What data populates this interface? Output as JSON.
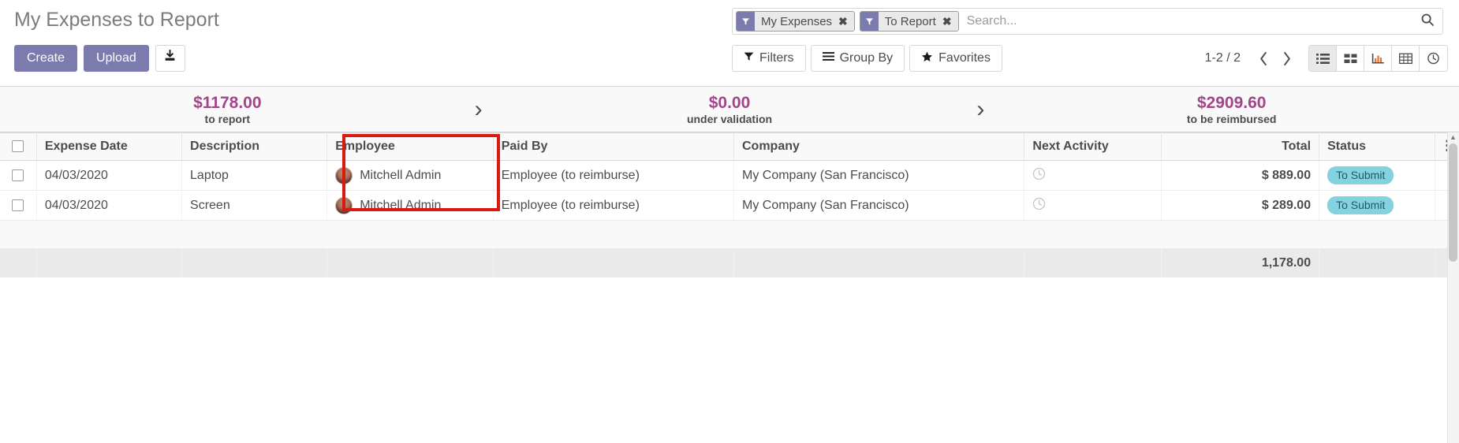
{
  "header": {
    "title": "My Expenses to Report",
    "buttons": {
      "create": "Create",
      "upload": "Upload",
      "import_icon": "download-tray-icon"
    }
  },
  "search": {
    "placeholder": "Search...",
    "value": "",
    "search_icon": "search-icon",
    "facets": [
      {
        "icon": "filter-funnel-icon",
        "label": "My Expenses",
        "close": "✖"
      },
      {
        "icon": "filter-funnel-icon",
        "label": "To Report",
        "close": "✖"
      }
    ]
  },
  "toolbar": {
    "filters": "Filters",
    "filters_icon": "funnel-icon",
    "group_by": "Group By",
    "group_by_icon": "bars-icon",
    "favorites": "Favorites",
    "favorites_icon": "star-icon"
  },
  "pager": {
    "range": "1-2 / 2",
    "prev_icon": "chevron-left-icon",
    "next_icon": "chevron-right-icon"
  },
  "views": [
    {
      "name": "list-view",
      "icon": "list-icon",
      "active": true
    },
    {
      "name": "kanban-view",
      "icon": "kanban-grid-icon",
      "active": false
    },
    {
      "name": "graph-view",
      "icon": "bar-chart-icon",
      "active": false
    },
    {
      "name": "pivot-view",
      "icon": "table-grid-icon",
      "active": false
    },
    {
      "name": "activity-view",
      "icon": "clock-icon",
      "active": false
    }
  ],
  "dashboard": {
    "separator": "›",
    "cells": [
      {
        "amount": "$1178.00",
        "label": "to report"
      },
      {
        "amount": "$0.00",
        "label": "under validation"
      },
      {
        "amount": "$2909.60",
        "label": "to be reimbursed"
      }
    ]
  },
  "table": {
    "columns": [
      "Expense Date",
      "Description",
      "Employee",
      "Paid By",
      "Company",
      "Next Activity",
      "Total",
      "Status"
    ],
    "optional_columns_icon": "vertical-dots-icon",
    "rows": [
      {
        "date": "04/03/2020",
        "description": "Laptop",
        "employee": "Mitchell Admin",
        "employee_avatar": "user-avatar",
        "paid_by": "Employee (to reimburse)",
        "company": "My Company (San Francisco)",
        "next_activity": "clock-icon",
        "total": "$ 889.00",
        "status": "To Submit"
      },
      {
        "date": "04/03/2020",
        "description": "Screen",
        "employee": "Mitchell Admin",
        "employee_avatar": "user-avatar",
        "paid_by": "Employee (to reimburse)",
        "company": "My Company (San Francisco)",
        "next_activity": "clock-icon",
        "total": "$ 289.00",
        "status": "To Submit"
      }
    ],
    "footer_total": "1,178.00"
  },
  "annotation": {
    "color": "#d91a11",
    "target_column": "Employee"
  },
  "colors": {
    "primary": "#7c7bad",
    "amount": "#a24689",
    "badge_bg": "#84d1e0",
    "highlight": "#d91a11"
  }
}
